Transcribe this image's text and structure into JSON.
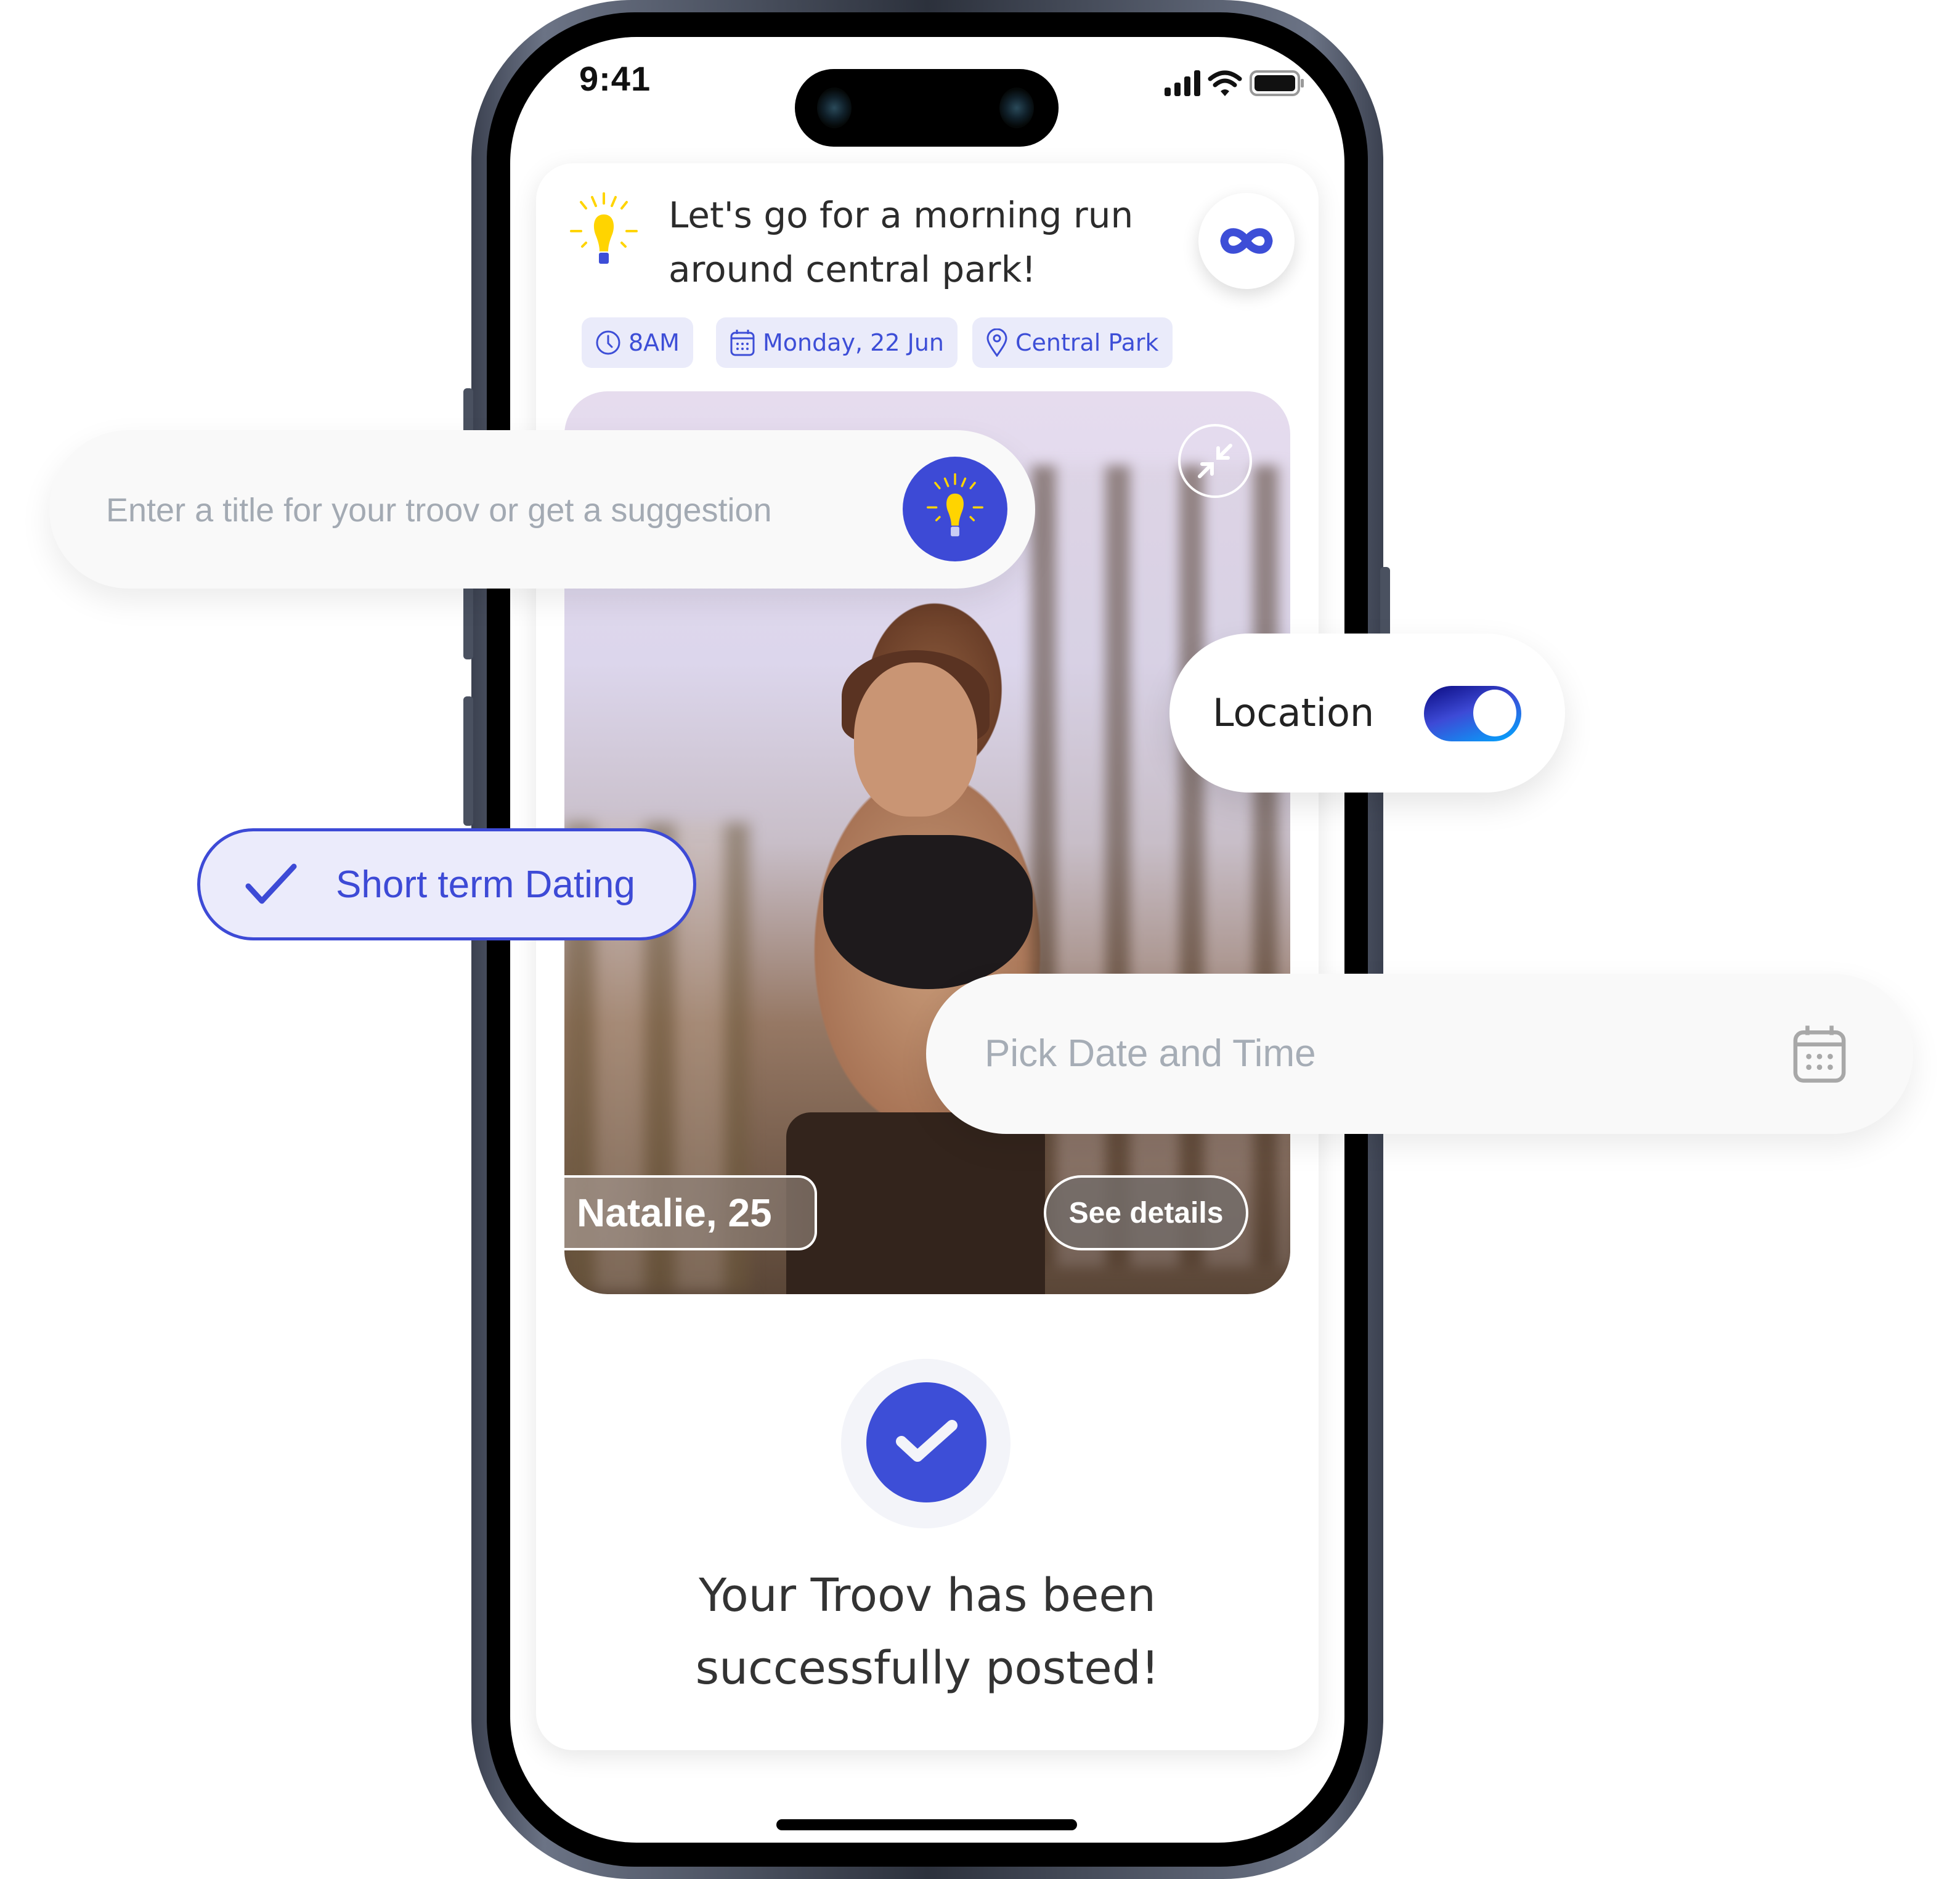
{
  "status_bar": {
    "time": "9:41"
  },
  "card": {
    "title": "Let's go for a morning run around central park!",
    "tags": [
      {
        "icon": "clock-icon",
        "label": "8AM"
      },
      {
        "icon": "calendar-icon",
        "label": "Monday, 22 Jun"
      },
      {
        "icon": "location-pin-icon",
        "label": "Central Park"
      }
    ],
    "profile": {
      "name_age": "Natalie, 25",
      "details_button": "See details"
    },
    "success_message": "Your Troov has been successfully posted!"
  },
  "title_input": {
    "value": "",
    "placeholder": "Enter a title for your troov or get a suggestion"
  },
  "location_toggle": {
    "label": "Location",
    "enabled": true
  },
  "intent_chip": {
    "label": "Short term Dating",
    "selected": true
  },
  "date_picker": {
    "placeholder": "Pick Date and Time"
  },
  "colors": {
    "accent": "#3d4ed7",
    "tag_bg": "#eaebfa",
    "bulb": "#ffd400",
    "chip_bg": "#ebebfb",
    "placeholder": "#a3aab3"
  }
}
